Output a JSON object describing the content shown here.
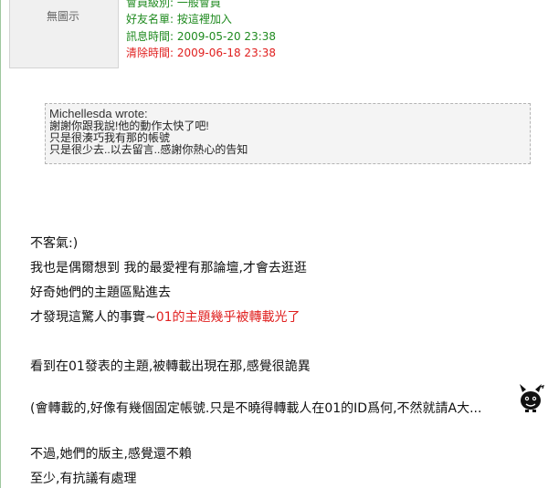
{
  "avatar": {
    "placeholder": "無圖示"
  },
  "member_info": {
    "rank_label": "會員級別:",
    "rank_value": "一般會員",
    "friend_label": "好友名單:",
    "friend_value": "按這裡加入",
    "msg_time_label": "訊息時間:",
    "msg_time_value": "2009-05-20 23:38",
    "del_time_label": "清除時間:",
    "del_time_value": "2009-06-18 23:38"
  },
  "quote": {
    "author": "Michellesda wrote:",
    "lines": [
      "謝謝你跟我說!他的動作太快了吧!",
      "只是很湊巧我有那的帳號",
      "只是很少去..以去留言..感謝你熱心的告知"
    ]
  },
  "reply": {
    "line1": "不客氣:)",
    "line2": "我也是偶爾想到 我的最愛裡有那論壇,才會去逛逛",
    "line3": "好奇她們的主題區點進去",
    "line4_plain": "才發現這驚人的事實~",
    "line4_red": "01的主題幾乎被轉載光了",
    "line5": "看到在01發表的主題,被轉載出現在那,感覺很詭異",
    "line6": "(會轉載的,好像有幾個固定帳號.只是不曉得轉載人在01的ID爲何,不然就請A大...",
    "line7": "不過,她們的版主,感覺還不賴",
    "line8": "至少,有抗議有處理"
  },
  "colors": {
    "green": "#1f8a1f",
    "red": "#e0201f",
    "quote_bg": "#f4f4f4"
  },
  "icons": {
    "emoticon": "devil-emoticon-icon"
  }
}
